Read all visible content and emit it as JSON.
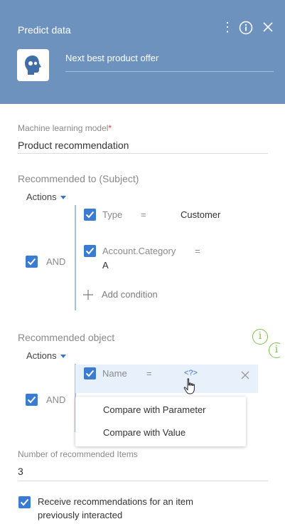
{
  "header": {
    "title": "Predict data",
    "record_name": "Next best product offer",
    "bg_color": "#6d92be"
  },
  "model": {
    "label": "Machine learning model",
    "required_mark": "*",
    "value": "Product recommendation"
  },
  "subject": {
    "title": "Recommended to (Subject)",
    "actions_label": "Actions",
    "group_operator": "AND",
    "conditions": [
      {
        "field": "Type",
        "op": "=",
        "value": "Customer"
      },
      {
        "field": "Account.Category",
        "op": "=",
        "value": "A"
      }
    ],
    "add_condition_label": "Add condition"
  },
  "object": {
    "title": "Recommended object",
    "actions_label": "Actions",
    "group_operator": "AND",
    "condition": {
      "field": "Name",
      "op": "=",
      "value": "<?>"
    }
  },
  "context_menu": {
    "items": [
      "Compare with Parameter",
      "Compare with Value"
    ]
  },
  "items_count": {
    "label": "Number of recommended Items",
    "value": "3"
  },
  "receive_recommendations": {
    "label": "Receive recommendations for an item previously interacted",
    "checked": true
  },
  "colors": {
    "accent": "#3b7bd1",
    "info_green": "#7fbf4d",
    "required": "#e23c3c"
  }
}
